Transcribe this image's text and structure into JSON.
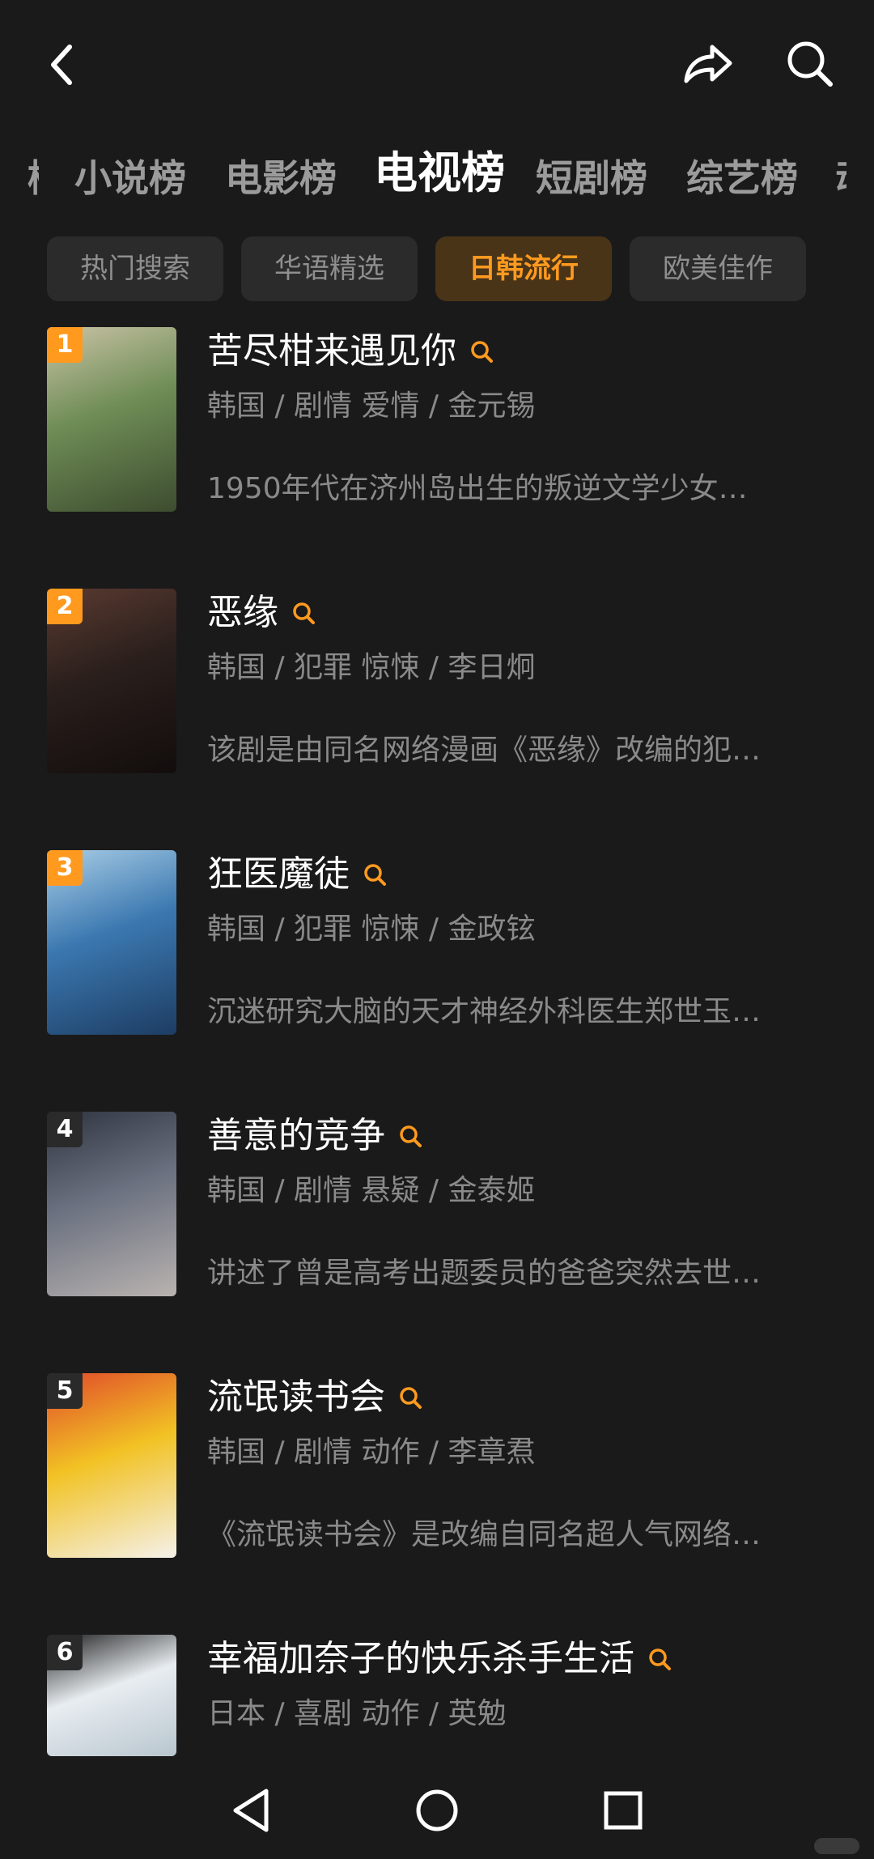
{
  "header": {
    "back_icon": "chevron-left-icon",
    "share_icon": "share-arrow-icon",
    "search_icon": "search-icon"
  },
  "tabs": [
    {
      "label": "小说榜",
      "active": false
    },
    {
      "label": "电影榜",
      "active": false
    },
    {
      "label": "电视榜",
      "active": true
    },
    {
      "label": "短剧榜",
      "active": false
    },
    {
      "label": "综艺榜",
      "active": false
    }
  ],
  "chips": [
    {
      "label": "热门搜索",
      "active": false
    },
    {
      "label": "华语精选",
      "active": false
    },
    {
      "label": "日韩流行",
      "active": true
    },
    {
      "label": "欧美佳作",
      "active": false
    }
  ],
  "items": [
    {
      "rank": "1",
      "title": "苦尽柑来遇见你",
      "meta": "韩国 / 剧情 爱情 / 金元锡",
      "desc": "1950年代在济州岛出生的叛逆文学少女…",
      "poster_colors": [
        "#6f8d56",
        "#c9c3a6",
        "#3d4c2f"
      ]
    },
    {
      "rank": "2",
      "title": "恶缘",
      "meta": "韩国 / 犯罪 惊悚 / 李日炯",
      "desc": "该剧是由同名网络漫画《恶缘》改编的犯…",
      "poster_colors": [
        "#2a1f1c",
        "#5a3a30",
        "#120d0c"
      ]
    },
    {
      "rank": "3",
      "title": "狂医魔徒",
      "meta": "韩国 / 犯罪 惊悚 / 金政铉",
      "desc": "沉迷研究大脑的天才神经外科医生郑世玉…",
      "poster_colors": [
        "#3b78b0",
        "#a9cde6",
        "#1d3d63"
      ]
    },
    {
      "rank": "4",
      "title": "善意的竞争",
      "meta": "韩国 / 剧情 悬疑 / 金泰姬",
      "desc": "讲述了曾是高考出题委员的爸爸突然去世…",
      "poster_colors": [
        "#6b7180",
        "#2f3440",
        "#b9b3b0"
      ]
    },
    {
      "rank": "5",
      "title": "流氓读书会",
      "meta": "韩国 / 剧情 动作 / 李章焄",
      "desc": "《流氓读书会》是改编自同名超人气网络…",
      "poster_colors": [
        "#f2c224",
        "#e04a2a",
        "#f4f1ea"
      ]
    },
    {
      "rank": "6",
      "title": "幸福加奈子的快乐杀手生活",
      "meta": "日本 / 喜剧 动作 / 英勉",
      "desc": "",
      "poster_colors": [
        "#e8edf1",
        "#1c1c1c",
        "#b9c6cf"
      ]
    }
  ],
  "navbar": {
    "back_icon": "triangle-back-icon",
    "home_icon": "circle-home-icon",
    "recents_icon": "square-recents-icon"
  },
  "colors": {
    "background": "#1a1a1a",
    "accent": "#ff9a1f",
    "chip_bg": "#2b2b2b",
    "chip_active_bg": "#4a3418",
    "muted_text": "#8a8a8a"
  }
}
